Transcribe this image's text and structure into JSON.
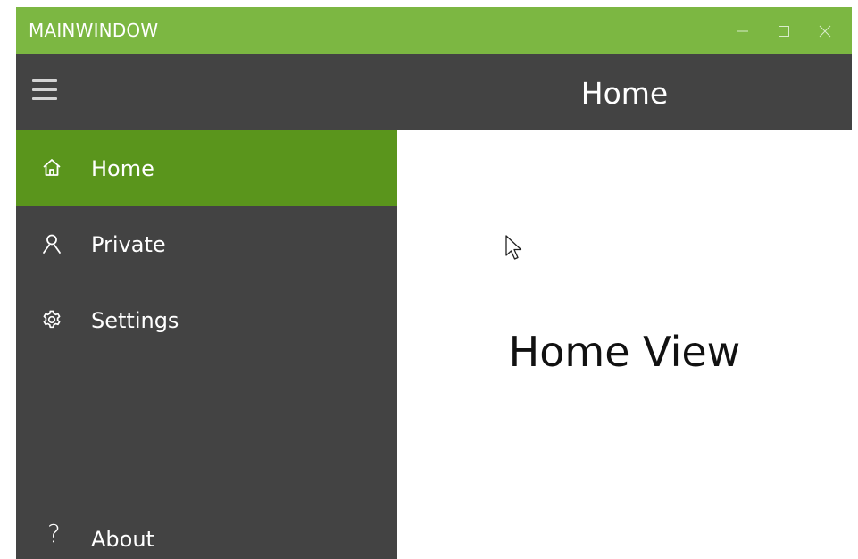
{
  "window": {
    "title": "MAINWINDOW",
    "accent_color": "#7cb742",
    "controls": {
      "minimize_icon": "minimize-icon",
      "maximize_icon": "maximize-icon",
      "close_icon": "close-icon"
    }
  },
  "header": {
    "menu_icon": "hamburger-menu-icon",
    "title": "Home",
    "background_color": "#434343"
  },
  "sidebar": {
    "background_color": "#434343",
    "selected_color": "#5a951c",
    "items": [
      {
        "label": "Home",
        "icon": "home-icon",
        "selected": true
      },
      {
        "label": "Private",
        "icon": "user-icon",
        "selected": false
      },
      {
        "label": "Settings",
        "icon": "gear-icon",
        "selected": false
      }
    ],
    "footer_items": [
      {
        "label": "About",
        "icon": "question-icon",
        "glyph": "?"
      }
    ]
  },
  "main": {
    "view_text": "Home View"
  }
}
